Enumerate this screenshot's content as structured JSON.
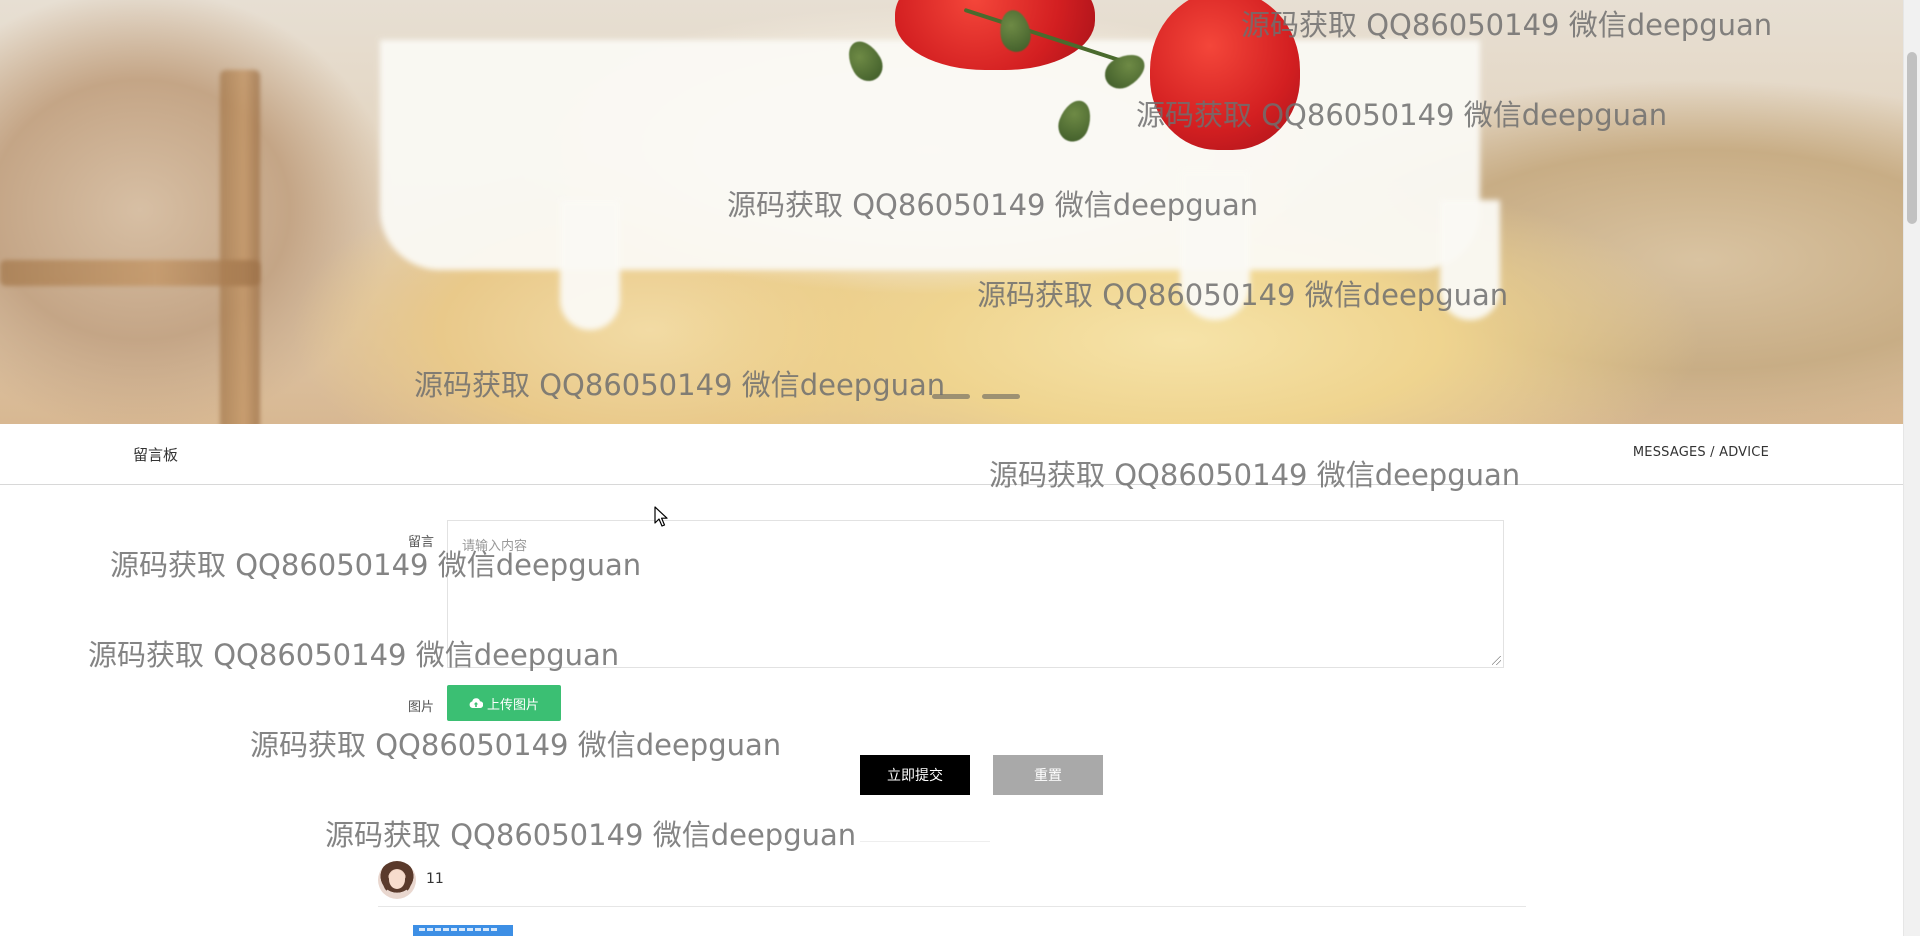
{
  "banner": {
    "carousel_dots": 2
  },
  "watermark_text": "源码获取 QQ86050149 微信deepguan",
  "section": {
    "title": "留言板",
    "subtitle": "MESSAGES / ADVICE"
  },
  "form": {
    "message_label": "留言",
    "message_placeholder": "请输入内容",
    "image_label": "图片",
    "upload_label": "上传图片",
    "submit_label": "立即提交",
    "reset_label": "重置"
  },
  "comments": [
    {
      "username": "11"
    }
  ],
  "colors": {
    "upload_button": "#3bbf73",
    "submit_button": "#000000",
    "reset_button": "#a9a9a9",
    "comment_image": "#3d8fe5"
  },
  "icons": {
    "upload": "cloud-upload-icon",
    "cursor": "mouse-pointer-icon"
  }
}
